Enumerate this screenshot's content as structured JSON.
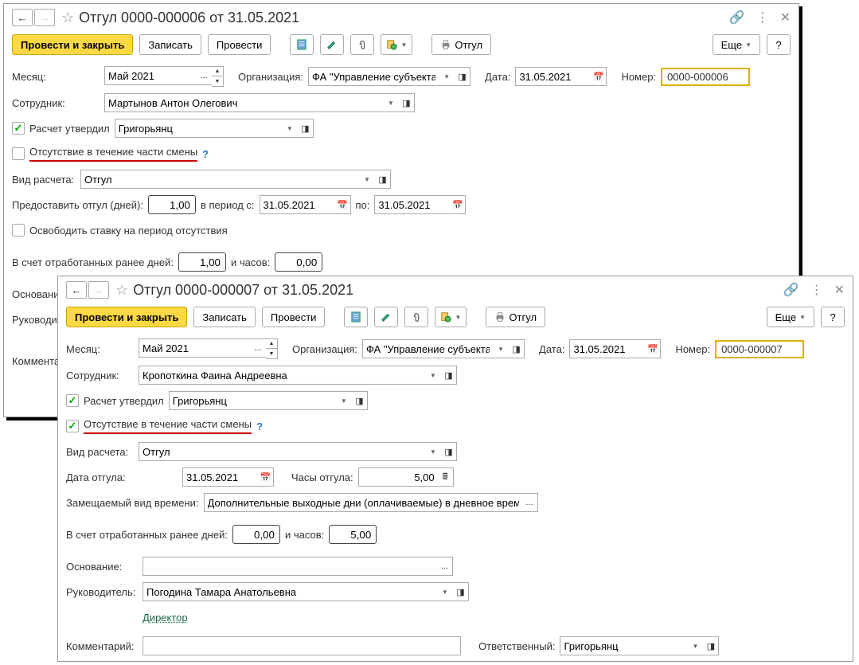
{
  "w1": {
    "title": "Отгул 0000-000006 от 31.05.2021",
    "toolbar": {
      "postclose": "Провести и закрыть",
      "save": "Записать",
      "post": "Провести",
      "otgul": "Отгул",
      "more": "Еще"
    },
    "month_label": "Месяц:",
    "month": "Май 2021",
    "org_label": "Организация:",
    "org": "ФА \"Управление субъекта",
    "date_label": "Дата:",
    "date": "31.05.2021",
    "number_label": "Номер:",
    "number": "0000-000006",
    "employee_label": "Сотрудник:",
    "employee": "Мартынов Антон Олегович",
    "approved_label": "Расчет утвердил",
    "approved_by": "Григорьянц",
    "partial_shift_label": "Отсутствие в течение части смены",
    "calc_type_label": "Вид расчета:",
    "calc_type": "Отгул",
    "provide_days_label": "Предоставить отгул (дней):",
    "provide_days": "1,00",
    "period_from_label": "в период с:",
    "period_from": "31.05.2021",
    "period_to_label": "по:",
    "period_to": "31.05.2021",
    "release_rate_label": "Освободить ставку на период отсутствия",
    "worked_days_label": "В счет отработанных ранее дней:",
    "worked_days": "1,00",
    "worked_hours_label": "и часов:",
    "worked_hours": "0,00",
    "basis_label": "Основание",
    "manager_label": "Руководит",
    "comment_label": "Комментар"
  },
  "w2": {
    "title": "Отгул 0000-000007 от 31.05.2021",
    "toolbar": {
      "postclose": "Провести и закрыть",
      "save": "Записать",
      "post": "Провести",
      "otgul": "Отгул",
      "more": "Еще"
    },
    "month_label": "Месяц:",
    "month": "Май 2021",
    "org_label": "Организация:",
    "org": "ФА \"Управление субъекта",
    "date_label": "Дата:",
    "date": "31.05.2021",
    "number_label": "Номер:",
    "number": "0000-000007",
    "employee_label": "Сотрудник:",
    "employee": "Кропоткина Фаина Андреевна",
    "approved_label": "Расчет утвердил",
    "approved_by": "Григорьянц",
    "partial_shift_label": "Отсутствие в течение части смены",
    "calc_type_label": "Вид расчета:",
    "calc_type": "Отгул",
    "date_off_label": "Дата отгула:",
    "date_off": "31.05.2021",
    "hours_off_label": "Часы отгула:",
    "hours_off": "5,00",
    "replaced_type_label": "Замещаемый вид времени:",
    "replaced_type": "Дополнительные выходные дни (оплачиваемые) в дневное время",
    "worked_days_label": "В счет отработанных ранее дней:",
    "worked_days": "0,00",
    "worked_hours_label": "и часов:",
    "worked_hours": "5,00",
    "basis_label": "Основание:",
    "manager_label": "Руководитель:",
    "manager": "Погодина Тамара Анатольевна",
    "director_link": "Директор",
    "comment_label": "Комментарий:",
    "responsible_label": "Ответственный:",
    "responsible": "Григорьянц"
  }
}
